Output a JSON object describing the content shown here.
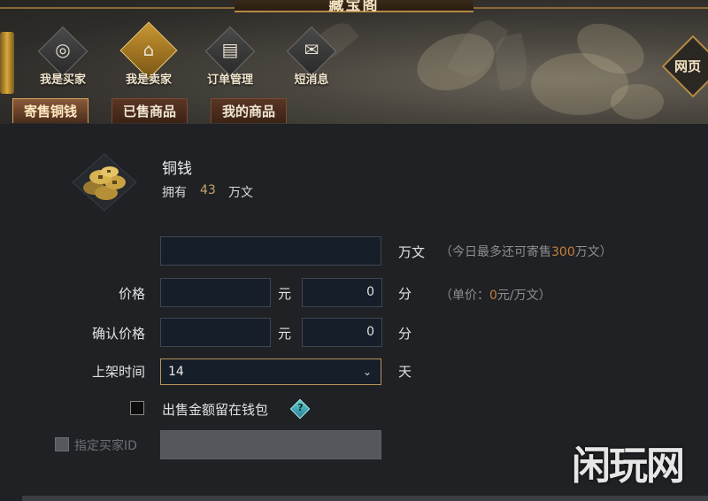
{
  "window": {
    "title": "藏宝阁"
  },
  "nav": {
    "items": [
      {
        "label": "我是买家",
        "icon": "coin-icon",
        "glyph": "◎"
      },
      {
        "label": "我是卖家",
        "icon": "stall-icon",
        "glyph": "⌂"
      },
      {
        "label": "订单管理",
        "icon": "book-icon",
        "glyph": "▤"
      },
      {
        "label": "短消息",
        "icon": "envelope-icon",
        "glyph": "✉"
      }
    ],
    "active": "我是卖家",
    "webpage_label": "网页"
  },
  "tabs": [
    {
      "label": "寄售铜钱",
      "active": true
    },
    {
      "label": "已售商品",
      "active": false
    },
    {
      "label": "我的商品",
      "active": false
    }
  ],
  "item": {
    "icon": "copper-coins-icon",
    "name": "铜钱",
    "own_label": "拥有",
    "own_value": "43",
    "own_unit": "万文"
  },
  "form": {
    "amount": {
      "value": "",
      "unit": "万文",
      "hint_prefix": "（今日最多还可寄售",
      "hint_value": "300",
      "hint_suffix": "万文）"
    },
    "price": {
      "label": "价格",
      "yuan_value": "",
      "yuan_unit": "元",
      "fen_value": "0",
      "fen_unit": "分",
      "hint_prefix": "（单价：",
      "hint_value": "0",
      "hint_suffix": "元/万文）"
    },
    "confirm_price": {
      "label": "确认价格",
      "yuan_value": "",
      "yuan_unit": "元",
      "fen_value": "0",
      "fen_unit": "分"
    },
    "listing_time": {
      "label": "上架时间",
      "value": "14",
      "unit": "天"
    },
    "keep_in_wallet": {
      "label": "出售金额留在钱包",
      "checked": false,
      "help_glyph": "?"
    },
    "buyer_id": {
      "label": "指定买家ID",
      "checked": false,
      "enabled": false,
      "value": ""
    }
  },
  "watermark": "闲玩网",
  "colors": {
    "accent_gold": "#b89458",
    "hint_orange": "#c87e3a",
    "field_bg": "#161e29",
    "panel_bg": "#1f2124"
  }
}
